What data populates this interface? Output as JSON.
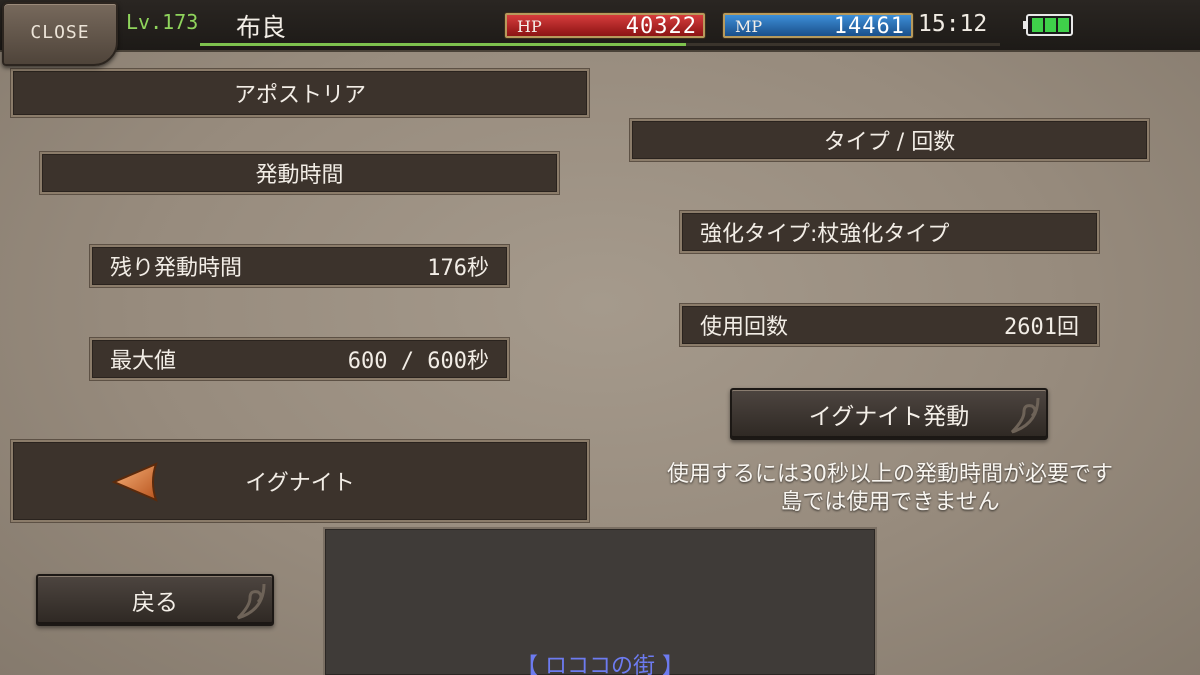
{
  "header": {
    "close_label": "CLOSE",
    "level": "Lv.173",
    "player_name": "布良",
    "hp_label": "HP",
    "hp_value": "40322",
    "mp_label": "MP",
    "mp_value": "14461",
    "time": "15:12",
    "colors": {
      "level": "#8fd45c",
      "hp": "#c0282b",
      "mp": "#2c6fb8",
      "battery": "#3fd04a"
    }
  },
  "left": {
    "title": "アポストリア",
    "duration_header": "発動時間",
    "remaining_label": "残り発動時間",
    "remaining_value": "176秒",
    "max_label": "最大値",
    "max_value": "600 / 600秒",
    "skill_name": "イグナイト",
    "back_label": "戻る"
  },
  "right": {
    "type_header": "タイプ / 回数",
    "enhance_type": "強化タイプ:杖強化タイプ",
    "use_count_label": "使用回数",
    "use_count_value": "2601回",
    "activate_label": "イグナイト発動",
    "message_line1": "使用するには30秒以上の発動時間が必要です",
    "message_line2": "島では使用できません"
  },
  "map": {
    "location": "【 ロココの街 】"
  },
  "icons": [
    "left-arrow-icon",
    "battery-icon",
    "scroll-ornament-icon"
  ]
}
